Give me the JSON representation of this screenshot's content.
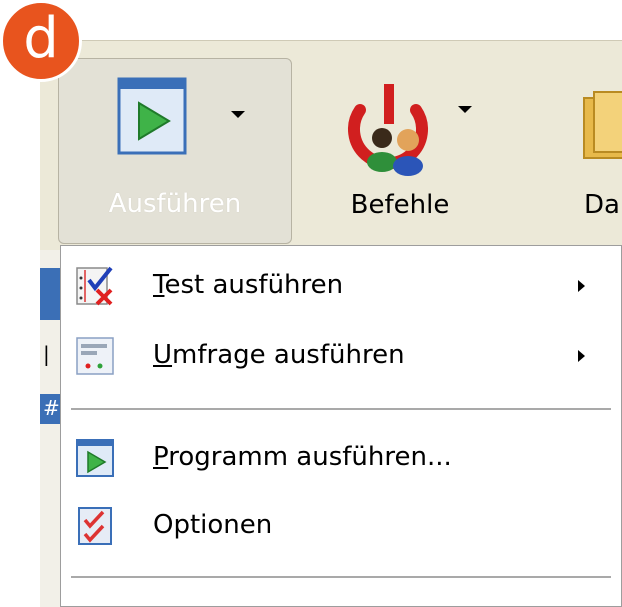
{
  "badge": {
    "letter": "d",
    "color": "#e8541e"
  },
  "toolbar": {
    "buttons": [
      {
        "label": "Ausführen",
        "icon": "play-window-icon",
        "has_dropdown": true,
        "active": true
      },
      {
        "label": "Befehle",
        "icon": "power-users-icon",
        "has_dropdown": true,
        "active": false
      },
      {
        "label": "Da",
        "icon": "folder-icon",
        "has_dropdown": false,
        "active": false
      }
    ]
  },
  "menu": {
    "items": [
      {
        "mnemonic": "T",
        "rest": "est ausführen",
        "icon": "test-checklist-icon",
        "submenu": true
      },
      {
        "mnemonic": "U",
        "rest": "mfrage ausführen",
        "icon": "survey-icon",
        "submenu": true
      },
      {
        "mnemonic": "P",
        "rest": "rogramm ausführen...",
        "icon": "run-program-icon",
        "submenu": false
      },
      {
        "mnemonic": "",
        "rest": "Optionen",
        "icon": "options-checklist-icon",
        "submenu": false
      }
    ]
  },
  "background_strip": {
    "chars": [
      "|",
      "#"
    ]
  }
}
